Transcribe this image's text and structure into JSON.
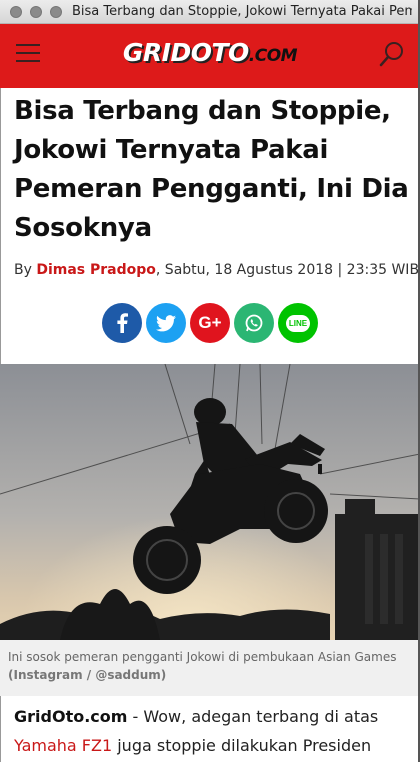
{
  "window": {
    "title": "Bisa Terbang dan Stoppie, Jokowi Ternyata Pakai Pemer..."
  },
  "site": {
    "logo_main": "GRIDOTO",
    "logo_suffix": ".COM",
    "brand_color": "#dd1a1a",
    "menu_icon": "hamburger-menu-icon",
    "search_icon": "search-icon"
  },
  "article": {
    "headline": "Bisa Terbang dan Stoppie, Jokowi Ternyata Pakai Pemeran Pengganti, Ini Dia Sosoknya",
    "by": "By ",
    "author": "Dimas Pradopo",
    "date": ", Sabtu, 18 Agustus 2018 | 23:35 WIB",
    "share": [
      {
        "icon": "facebook-icon",
        "label": "f",
        "color": "#1e5aa8"
      },
      {
        "icon": "twitter-icon",
        "label": "t",
        "color": "#1da1f2"
      },
      {
        "icon": "google-plus-icon",
        "label": "G+",
        "color": "#e0141e"
      },
      {
        "icon": "whatsapp-icon",
        "label": "wa",
        "color": "#2bb673"
      },
      {
        "icon": "line-icon",
        "label": "LINE",
        "color": "#00c300"
      }
    ],
    "caption": "Ini sosok pemeran pengganti Jokowi di pembukaan Asian Games",
    "caption_credit": "(Instagram / @saddum)",
    "body_brand": "GridOto.com",
    "body_part1": " - Wow, adegan terbang di atas ",
    "body_link": "Yamaha FZ1",
    "body_part2": " juga stoppie dilakukan Presiden"
  }
}
